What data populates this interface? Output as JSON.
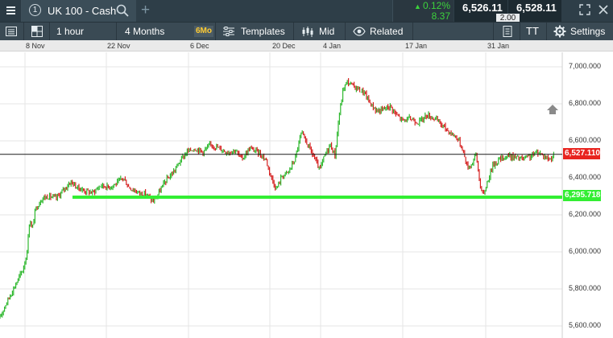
{
  "header": {
    "menu_icon": "hamburger-icon",
    "tab_number": "1",
    "instrument": "UK 100 - Cash",
    "search_icon": "search-icon",
    "add_tab": "+",
    "change_pct": "0.12%",
    "change_pts": "8.37",
    "sell_price": "6,526.11",
    "buy_price": "6,528.11",
    "spread": "2.00",
    "up_color": "#3cd23c"
  },
  "toolbar": {
    "interval": "1 hour",
    "period": "4 Months",
    "period_badge": "6Mo",
    "templates": "Templates",
    "price_type": "Mid",
    "related": "Related",
    "settings": "Settings",
    "text_tool": "TT"
  },
  "chart": {
    "x_labels": [
      "8 Nov",
      "22 Nov",
      "6 Dec",
      "20 Dec",
      "4 Jan",
      "17 Jan",
      "31 Jan"
    ],
    "y_labels": [
      "7,000.000",
      "6,800.000",
      "6,600.000",
      "6,400.000",
      "6,200.000",
      "6,000.000",
      "5,800.000",
      "5,600.000"
    ],
    "current_price": "6,527.110",
    "support_price": "6,295.718",
    "support_value": 6295.718,
    "current_value": 6527.11,
    "current_color": "#e8241f",
    "support_color": "#33ee33"
  },
  "chart_data": {
    "type": "line",
    "x": [
      "8 Nov",
      "22 Nov",
      "6 Dec",
      "20 Dec",
      "4 Jan",
      "17 Jan",
      "31 Jan"
    ],
    "series": [
      {
        "values": [
          6300,
          6360,
          6540,
          6560,
          6860,
          6740,
          6520
        ]
      }
    ],
    "ylim": [
      5560,
      7040
    ],
    "grid": true
  }
}
